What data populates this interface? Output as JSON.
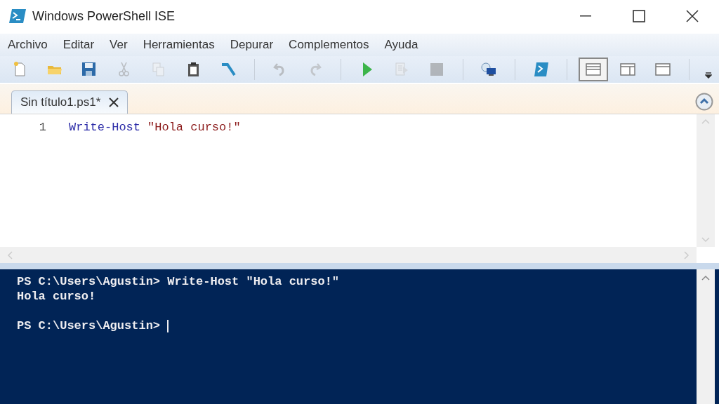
{
  "window": {
    "title": "Windows PowerShell ISE"
  },
  "menu": [
    {
      "label": "Archivo"
    },
    {
      "label": "Editar"
    },
    {
      "label": "Ver"
    },
    {
      "label": "Herramientas"
    },
    {
      "label": "Depurar"
    },
    {
      "label": "Complementos"
    },
    {
      "label": "Ayuda"
    }
  ],
  "toolbar": [
    {
      "kind": "new",
      "disabled": false
    },
    {
      "kind": "open",
      "disabled": false
    },
    {
      "kind": "save",
      "disabled": false
    },
    {
      "kind": "cut",
      "disabled": true
    },
    {
      "kind": "copy",
      "disabled": true
    },
    {
      "kind": "paste",
      "disabled": false
    },
    {
      "kind": "clear",
      "disabled": false
    },
    {
      "kind": "separator"
    },
    {
      "kind": "undo",
      "disabled": true
    },
    {
      "kind": "redo",
      "disabled": true
    },
    {
      "kind": "separator"
    },
    {
      "kind": "run",
      "disabled": false
    },
    {
      "kind": "run-selection",
      "disabled": true
    },
    {
      "kind": "stop",
      "disabled": true
    },
    {
      "kind": "separator"
    },
    {
      "kind": "remote",
      "disabled": false
    },
    {
      "kind": "separator"
    },
    {
      "kind": "console",
      "disabled": false
    },
    {
      "kind": "separator"
    },
    {
      "kind": "layout-top",
      "selected": true
    },
    {
      "kind": "layout-right",
      "selected": false
    },
    {
      "kind": "layout-max",
      "selected": false
    },
    {
      "kind": "separator"
    },
    {
      "kind": "overflow"
    }
  ],
  "tabs": [
    {
      "label": "Sin título1.ps1*",
      "selected": true
    }
  ],
  "editor": {
    "lines": [
      {
        "number": "1",
        "tokens": [
          {
            "kind": "command",
            "text": "Write-Host"
          },
          {
            "kind": "string",
            "text": "\"Hola curso!\""
          }
        ]
      }
    ]
  },
  "console": {
    "lines": [
      {
        "kind": "text",
        "text": "PS C:\\Users\\Agustin> Write-Host \"Hola curso!\""
      },
      {
        "kind": "text",
        "text": "Hola curso!"
      },
      {
        "kind": "blank"
      },
      {
        "kind": "prompt",
        "text": "PS C:\\Users\\Agustin>",
        "cursor": true
      }
    ]
  }
}
